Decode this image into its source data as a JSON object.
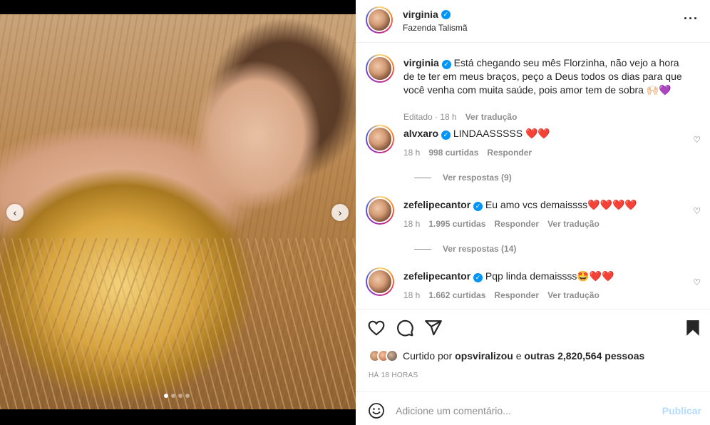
{
  "post": {
    "username": "virginia",
    "location": "Fazenda Talismã",
    "more_icon": "more-icon",
    "media": {
      "slide_count": 4,
      "active_slide": 1
    }
  },
  "caption": {
    "username": "virginia",
    "text": "Está chegando seu mês Florzinha, não vejo a hora de te ter em meus braços, peço a Deus todos os dias para que você venha com muita saúde, pois amor tem de sobra 🙌🏻💜",
    "edited": "Editado · 18 h",
    "translate": "Ver tradução"
  },
  "comments": [
    {
      "username": "alvxaro",
      "text": "LINDAASSSSS ❤️❤️",
      "time": "18 h",
      "likes": "998 curtidas",
      "reply": "Responder",
      "replies": "Ver respostas (9)"
    },
    {
      "username": "zefelipecantor",
      "text": "Eu amo vcs demaissss❤️❤️❤️❤️",
      "time": "18 h",
      "likes": "1.995 curtidas",
      "reply": "Responder",
      "translate": "Ver tradução",
      "replies": "Ver respostas (14)"
    },
    {
      "username": "zefelipecantor",
      "text": "Pqp linda demaissss🤩❤️❤️",
      "time": "18 h",
      "likes": "1.662 curtidas",
      "reply": "Responder",
      "translate": "Ver tradução"
    }
  ],
  "likes": {
    "prefix": "Curtido por",
    "user": "opsviralizou",
    "middle": "e",
    "others": "outras 2,820,564 pessoas"
  },
  "timestamp": "HÁ 18 HORAS",
  "composer": {
    "placeholder": "Adicione um comentário...",
    "publish": "Publicar"
  }
}
